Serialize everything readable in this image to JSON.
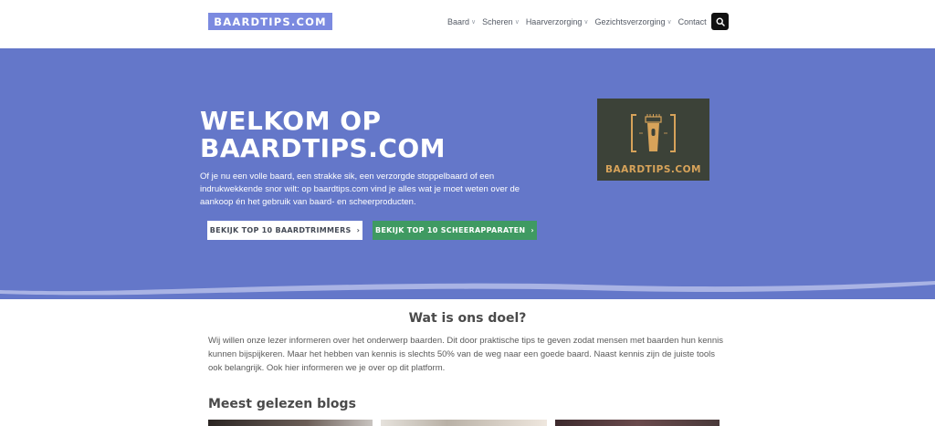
{
  "header": {
    "logo": "BAARDTIPS.COM",
    "nav": [
      {
        "label": "Baard",
        "has_dropdown": true
      },
      {
        "label": "Scheren",
        "has_dropdown": true
      },
      {
        "label": "Haarverzorging",
        "has_dropdown": true
      },
      {
        "label": "Gezichtsverzorging",
        "has_dropdown": true
      },
      {
        "label": "Contact",
        "has_dropdown": false
      }
    ],
    "search_icon": "search-icon"
  },
  "hero": {
    "title_line1": "WELKOM OP",
    "title_line2": "BAARDTIPS.COM",
    "intro": "Of je nu een volle baard, een strakke sik, een verzorgde stoppelbaard of een indrukwekkende snor wilt: op baardtips.com vind je alles wat je moet weten over de aankoop én het gebruik van baard- en scheerproducten.",
    "button_trimmers": "BEKIJK TOP 10 BAARDTRIMMERS",
    "button_scheer": "BEKIJK TOP 10 SCHEERAPPARATEN",
    "logo_image_text": "BAARDTIPS.COM"
  },
  "about": {
    "title": "Wat is ons doel?",
    "text": "Wij willen onze lezer informeren over het onderwerp baarden. Dit door praktische tips te geven zodat mensen met baarden hun kennis kunnen bijspijkeren. Maar het hebben van kennis is slechts 50% van de weg naar een goede baard. Naast kennis zijn de juiste tools ook belangrijk. Ook hier informeren we je over op dit platform."
  },
  "blogs": {
    "title": "Meest gelezen blogs"
  },
  "colors": {
    "hero_bg": "#6477c9",
    "logo_bg": "#7b8ae0",
    "green_button": "#3f9a62",
    "logo_gold": "#d7a35a"
  }
}
